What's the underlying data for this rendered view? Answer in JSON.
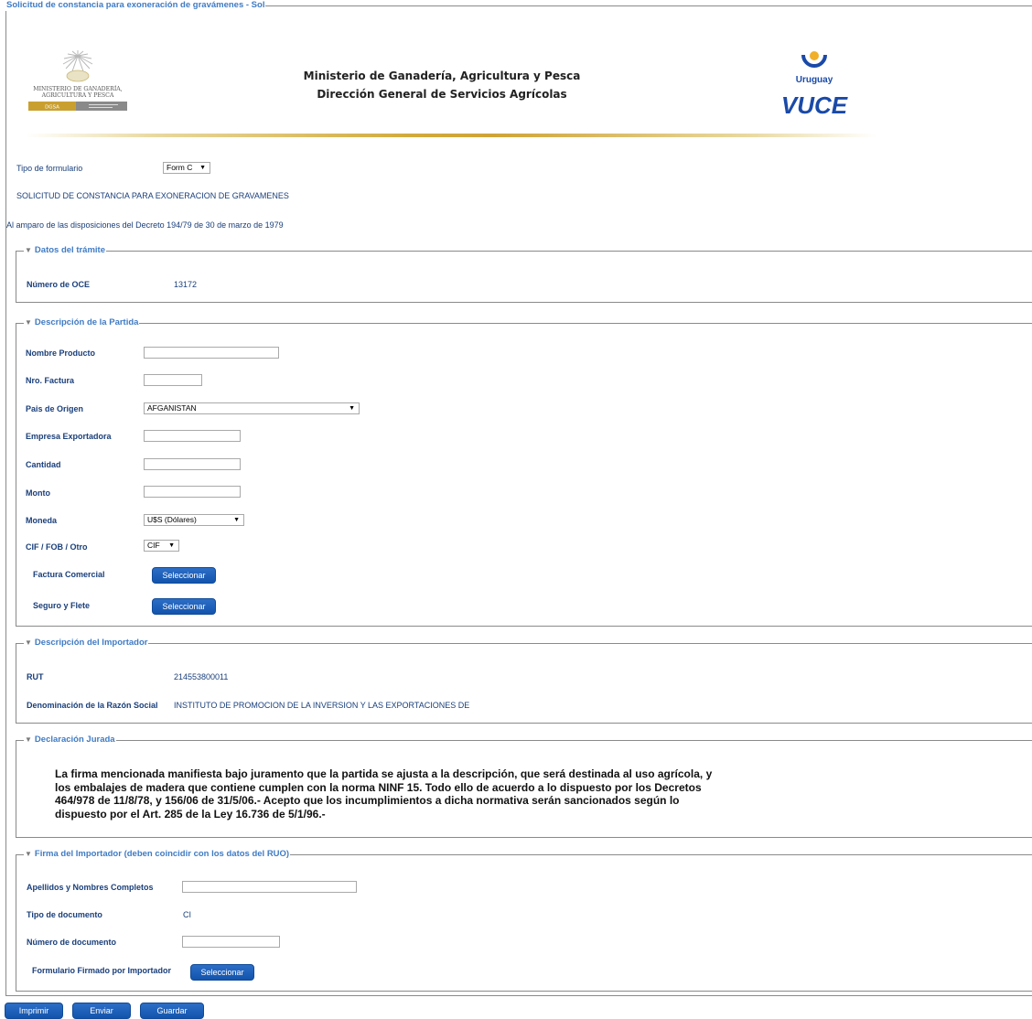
{
  "form": {
    "title": "Solicitud de constancia para exoneración de gravámenes - Sol"
  },
  "header": {
    "ministry_line1": "Ministerio de Ganadería, Agricultura y Pesca",
    "ministry_line2": "Dirección General de Servicios Agrícolas",
    "logo_left_text1": "MINISTERIO DE GANADERÍA,",
    "logo_left_text2": "AGRICULTURA Y PESCA",
    "logo_left_badge": "DGSA",
    "logo_right_country": "Uruguay",
    "logo_right_brand": "VUCE"
  },
  "tipo_formulario": {
    "label": "Tipo de formulario",
    "value": "Form C"
  },
  "heading": "SOLICITUD DE CONSTANCIA PARA EXONERACION DE GRAVAMENES",
  "decree": "Al amparo de las disposiciones del Decreto 194/79 de 30 de marzo de 1979",
  "datos_tramite": {
    "legend": "Datos del trámite",
    "oce_label": "Número de OCE",
    "oce_value": "13172"
  },
  "partida": {
    "legend": "Descripción de la Partida",
    "nombre_producto": "Nombre Producto",
    "nro_factura": "Nro. Factura",
    "pais_origen": "Pais de Origen",
    "pais_origen_value": "AFGANISTAN",
    "empresa_exportadora": "Empresa Exportadora",
    "cantidad": "Cantidad",
    "monto": "Monto",
    "moneda": "Moneda",
    "moneda_value": "U$S (Dólares)",
    "cif_fob": "CIF / FOB / Otro",
    "cif_fob_value": "CIF",
    "factura_comercial": "Factura Comercial",
    "seguro_flete": "Seguro y Flete",
    "select_button": "Seleccionar"
  },
  "importador": {
    "legend": "Descripción del Importador",
    "rut_label": "RUT",
    "rut_value": "214553800011",
    "razon_label": "Denominación de la Razón Social",
    "razon_value": "INSTITUTO DE PROMOCION DE LA INVERSION Y LAS EXPORTACIONES DE"
  },
  "declaracion": {
    "legend": "Declaración Jurada",
    "line1": "La firma mencionada manifiesta bajo juramento que la partida se ajusta a la descripción, que será destinada  al  uso  agrícola, y",
    "line2": "los embalajes de madera que contiene cumplen con la norma NINF 15.  Todo ello de acuerdo a lo dispuesto por los Decretos",
    "line3": "464/978 de 11/8/78, y 156/06 de 31/5/06.-     Acepto que los incumplimientos a dicha normativa serán sancionados según lo",
    "line4": "dispuesto por el Art. 285 de la Ley 16.736 de 5/1/96.-"
  },
  "firma": {
    "legend": "Firma del Importador (deben coincidir con los datos del RUO)",
    "apellidos": "Apellidos y Nombres Completos",
    "tipo_doc": "Tipo de documento",
    "tipo_doc_value": "CI",
    "numero_doc": "Número de documento",
    "formulario_firmado": "Formulario Firmado por Importador",
    "select_button": "Seleccionar"
  },
  "actions": {
    "imprimir": "Imprimir",
    "enviar": "Enviar",
    "guardar": "Guardar"
  }
}
